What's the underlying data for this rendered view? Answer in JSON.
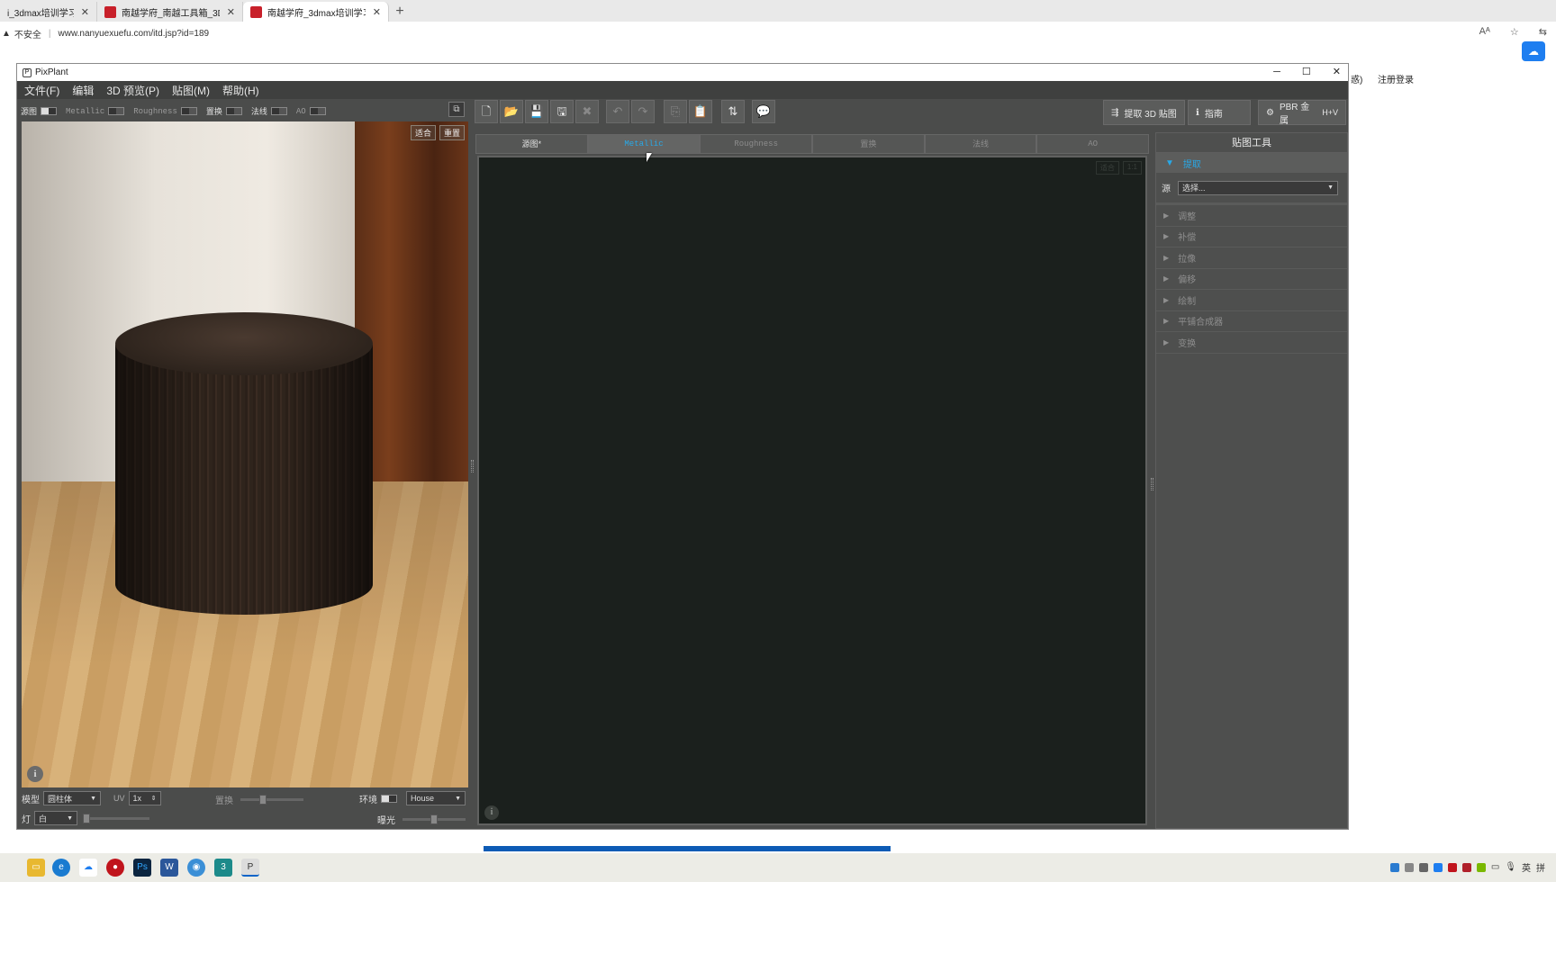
{
  "browser": {
    "tabs": [
      {
        "title": "i_3dmax培训学习网_学",
        "close": "✕"
      },
      {
        "title": "南越学府_南越工具箱_3D教程_主",
        "close": "✕"
      },
      {
        "title": "南越学府_3dmax培训学习网_南越",
        "close": "✕"
      }
    ],
    "new_tab": "+",
    "security_label": "不安全",
    "url": "www.nanyuexuefu.com/itd.jsp?id=189",
    "side_text_1": "惑)",
    "side_text_2": "注册登录"
  },
  "window": {
    "title": "PixPlant",
    "logo_glyph": "P",
    "controls": {
      "minimize": "─",
      "maximize": "☐",
      "close": "✕"
    },
    "menu": [
      "文件(F)",
      "编辑",
      "3D 预览(P)",
      "贴图(M)",
      "帮助(H)"
    ]
  },
  "left_panel": {
    "map_toggles": [
      {
        "label": "源图",
        "on": true
      },
      {
        "label": "Metallic",
        "on": false
      },
      {
        "label": "Roughness",
        "on": false
      },
      {
        "label": "置换",
        "on": false
      },
      {
        "label": "法线",
        "on": false
      },
      {
        "label": "AO",
        "on": false
      }
    ],
    "popout_glyph": "⧉",
    "viewport_buttons": {
      "fit": "适合",
      "reset": "重置"
    },
    "info_glyph": "i",
    "model_label": "模型",
    "model_value": "圆柱体",
    "uv_label": "UV",
    "uv_value": "1x",
    "displace_label": "置换",
    "displace_level": 0.35,
    "env_label": "环境",
    "env_value": "House",
    "light_label": "灯",
    "light_value": "白",
    "light_level": 0.0,
    "exposure_label": "曝光",
    "exposure_level": 0.5
  },
  "toolbar": {
    "icons": [
      "new-file-icon",
      "open-folder-icon",
      "save-icon",
      "save-as-icon",
      "close-x-icon",
      "undo-icon",
      "redo-icon",
      "copy-icon",
      "paste-icon",
      "swap-icon",
      "comment-icon"
    ],
    "extract_3d_label": "提取 3D 贴图",
    "guide_label": "指南",
    "pbr_label": "PBR 金属",
    "hv_label": "H+V"
  },
  "map_tabs": [
    "源图*",
    "Metallic",
    "Roughness",
    "置换",
    "法线",
    "AO"
  ],
  "selected_tab": 1,
  "canvas": {
    "fit": "适合",
    "zoom": "1:1",
    "info_glyph": "i"
  },
  "right_panel": {
    "title": "贴图工具",
    "open_section": "提取",
    "source_label": "源",
    "source_value": "选择...",
    "sections": [
      "调整",
      "补偿",
      "拉像",
      "偏移",
      "绘制",
      "平铺合成器",
      "变换"
    ]
  },
  "taskbar": {
    "tray": [
      "英",
      "拼"
    ]
  },
  "colors": {
    "accent": "#29a8e6",
    "panel": "#4b4c4b",
    "canvas": "#1b201d",
    "progress": "#0d5bb5"
  }
}
